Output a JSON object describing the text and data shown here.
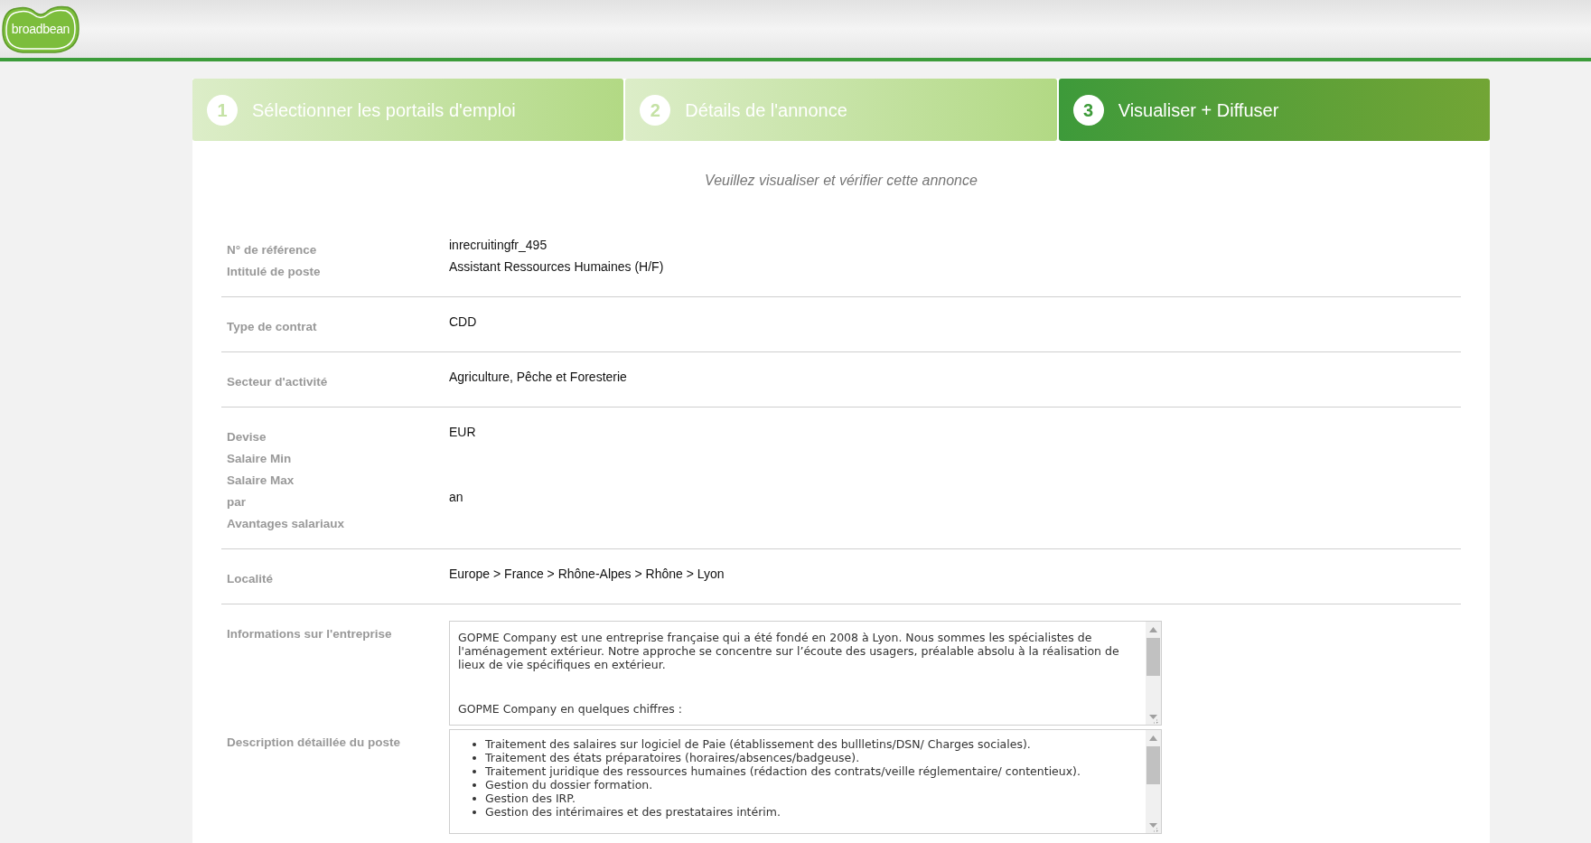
{
  "header": {
    "logo": "broadbean"
  },
  "steps": [
    {
      "number": "1",
      "label": "Sélectionner les portails d'emploi",
      "selected": false
    },
    {
      "number": "2",
      "label": "Détails de l'annonce",
      "selected": false
    },
    {
      "number": "3",
      "label": "Visualiser + Diffuser",
      "selected": true
    }
  ],
  "subtitle": "Veuillez visualiser et vérifier cette annonce",
  "sections": [
    {
      "rows": [
        {
          "kind": "text",
          "label": "N° de référence",
          "value": "inrecruitingfr_495"
        },
        {
          "kind": "text",
          "label": "Intitulé de poste",
          "value": "Assistant Ressources Humaines (H/F)"
        }
      ]
    },
    {
      "rows": [
        {
          "kind": "text",
          "label": "Type de contrat",
          "value": "CDD"
        }
      ]
    },
    {
      "rows": [
        {
          "kind": "text",
          "label": "Secteur d'activité",
          "value": "Agriculture, Pêche et Foresterie"
        }
      ]
    },
    {
      "rows": [
        {
          "kind": "text",
          "label": "Devise",
          "value": "EUR"
        },
        {
          "kind": "text",
          "label": "Salaire Min"
        },
        {
          "kind": "text",
          "label": "Salaire Max"
        },
        {
          "kind": "text",
          "label": "par",
          "value": "an"
        },
        {
          "kind": "text",
          "label": "Avantages salariaux"
        }
      ]
    },
    {
      "rows": [
        {
          "kind": "text",
          "label": "Localité",
          "value": "Europe > France > Rhône-Alpes > Rhône > Lyon"
        }
      ]
    },
    {
      "rows": [
        {
          "kind": "textarea",
          "label": "Informations sur l'entreprise",
          "paragraphs": [
            "GOPME Company est une entreprise française qui a été fondé en 2008 à Lyon. Nous sommes les spécialistes de l'aménagement extérieur. Notre approche se concentre sur l’écoute des usagers, préalable absolu à la réalisation de lieux de vie spécifiques en extérieur.",
            "GOPME Company en quelques chiffres :"
          ]
        },
        {
          "kind": "list",
          "label": "Description détaillée du poste",
          "items": [
            "Traitement des salaires sur logiciel de Paie (établissement des bullletins/DSN/ Charges sociales).",
            "Traitement des états préparatoires (horaires/absences/badgeuse).",
            "Traitement juridique des ressources humaines (rédaction des contrats/veille réglementaire/ contentieux).",
            "Gestion du dossier formation.",
            "Gestion des IRP.",
            "Gestion des intérimaires et des prestataires intérim."
          ]
        }
      ]
    }
  ]
}
